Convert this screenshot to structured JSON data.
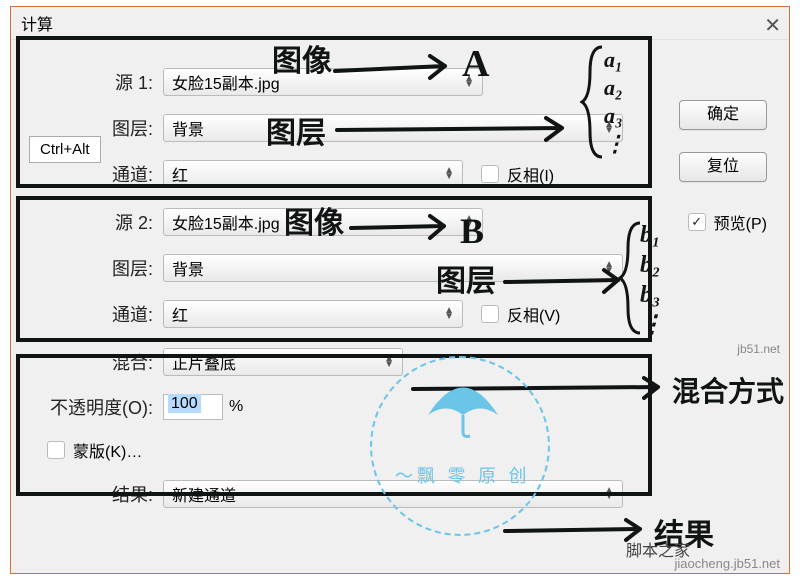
{
  "dialog": {
    "title": "计算",
    "close": "✕"
  },
  "tooltip": "Ctrl+Alt",
  "source1": {
    "label": "源 1:",
    "image_value": "女脸15副本.jpg",
    "layer_label": "图层:",
    "layer_value": "背景",
    "channel_label": "通道:",
    "channel_value": "红",
    "invert_label": "反相(I)"
  },
  "source2": {
    "label": "源 2:",
    "image_value": "女脸15副本.jpg",
    "layer_label": "图层:",
    "layer_value": "背景",
    "channel_label": "通道:",
    "channel_value": "红",
    "invert_label": "反相(V)"
  },
  "blending": {
    "label": "混合:",
    "value": "正片叠底",
    "opacity_label": "不透明度(O):",
    "opacity_value": "100",
    "opacity_unit": "%",
    "mask_label": "蒙版(K)…"
  },
  "result": {
    "label": "结果:",
    "value": "新建通道"
  },
  "buttons": {
    "ok": "确定",
    "reset": "复位"
  },
  "preview": {
    "label": "预览(P)",
    "checked": true
  },
  "annotations": {
    "image_a": "图像",
    "letter_a": "A",
    "layer_a": "图层",
    "brace_a": "a₁\na₂\na₃\n⋮",
    "image_b": "图像",
    "letter_b": "B",
    "layer_b": "图层",
    "brace_b": "b₁\nb₂\nb₃\n⋮",
    "blend_mode": "混合方式",
    "result": "结果"
  },
  "watermark": {
    "text": "～飘 零 原 创",
    "site1": "jb51.net",
    "site2": "jiaocheng.jb51.net",
    "site3": "脚本之家"
  }
}
